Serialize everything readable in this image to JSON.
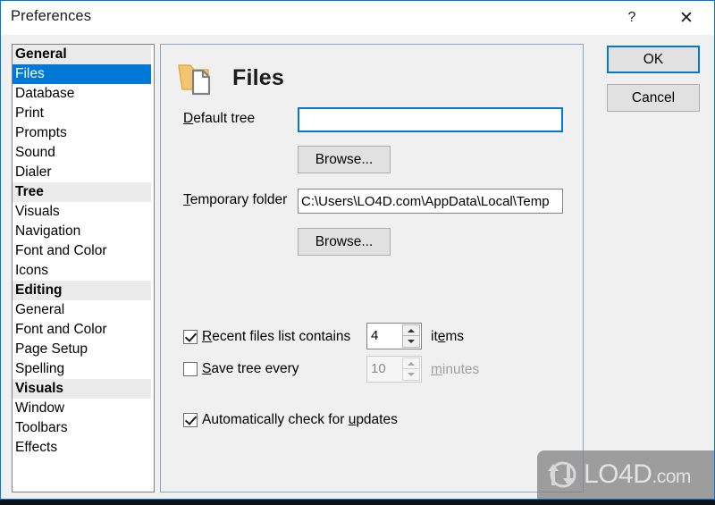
{
  "window": {
    "title": "Preferences",
    "help_glyph": "?",
    "close_glyph": "✕"
  },
  "sidebar": {
    "items": [
      {
        "label": "General",
        "type": "group"
      },
      {
        "label": "Files",
        "type": "item",
        "selected": true
      },
      {
        "label": "Database",
        "type": "item"
      },
      {
        "label": "Print",
        "type": "item"
      },
      {
        "label": "Prompts",
        "type": "item"
      },
      {
        "label": "Sound",
        "type": "item"
      },
      {
        "label": "Dialer",
        "type": "item"
      },
      {
        "label": "Tree",
        "type": "group"
      },
      {
        "label": "Visuals",
        "type": "item"
      },
      {
        "label": "Navigation",
        "type": "item"
      },
      {
        "label": "Font and Color",
        "type": "item"
      },
      {
        "label": "Icons",
        "type": "item"
      },
      {
        "label": "Editing",
        "type": "group"
      },
      {
        "label": "General",
        "type": "item"
      },
      {
        "label": "Font and Color",
        "type": "item"
      },
      {
        "label": "Page Setup",
        "type": "item"
      },
      {
        "label": "Spelling",
        "type": "item"
      },
      {
        "label": "Visuals",
        "type": "group"
      },
      {
        "label": "Window",
        "type": "item"
      },
      {
        "label": "Toolbars",
        "type": "item"
      },
      {
        "label": "Effects",
        "type": "item"
      }
    ]
  },
  "panel": {
    "page_title": "Files",
    "page_icon": "folder-document-icon",
    "default_tree": {
      "label_accel": "D",
      "label_rest": "efault tree",
      "value": "",
      "browse_label": "Browse..."
    },
    "temporary_folder": {
      "label_accel": "T",
      "label_rest": "emporary folder",
      "value": "C:\\Users\\LO4D.com\\AppData\\Local\\Temp",
      "browse_label": "Browse..."
    },
    "recent_files": {
      "checked": true,
      "label_accel": "R",
      "label_rest": "ecent files list contains",
      "value": "4",
      "unit_pre": "it",
      "unit_accel": "e",
      "unit_post": "ms"
    },
    "save_tree": {
      "checked": false,
      "label_accel": "S",
      "label_rest": "ave tree every",
      "value": "10",
      "unit_accel": "m",
      "unit_rest": "inutes",
      "disabled": true
    },
    "auto_update": {
      "checked": true,
      "label_pre": "Automatically check for ",
      "label_accel": "u",
      "label_rest": "pdates"
    }
  },
  "actions": {
    "ok_label": "OK",
    "cancel_label": "Cancel"
  },
  "watermark": {
    "name": "LO4D",
    "suffix": ".com"
  },
  "colors": {
    "accent": "#0078d7",
    "panel_bg": "#f0f0f0",
    "panel_border": "#8ba7c7",
    "list_border": "#828282",
    "group_bg": "#ebebeb",
    "folder_icon": "#f3c571",
    "document_icon": "#808080"
  }
}
